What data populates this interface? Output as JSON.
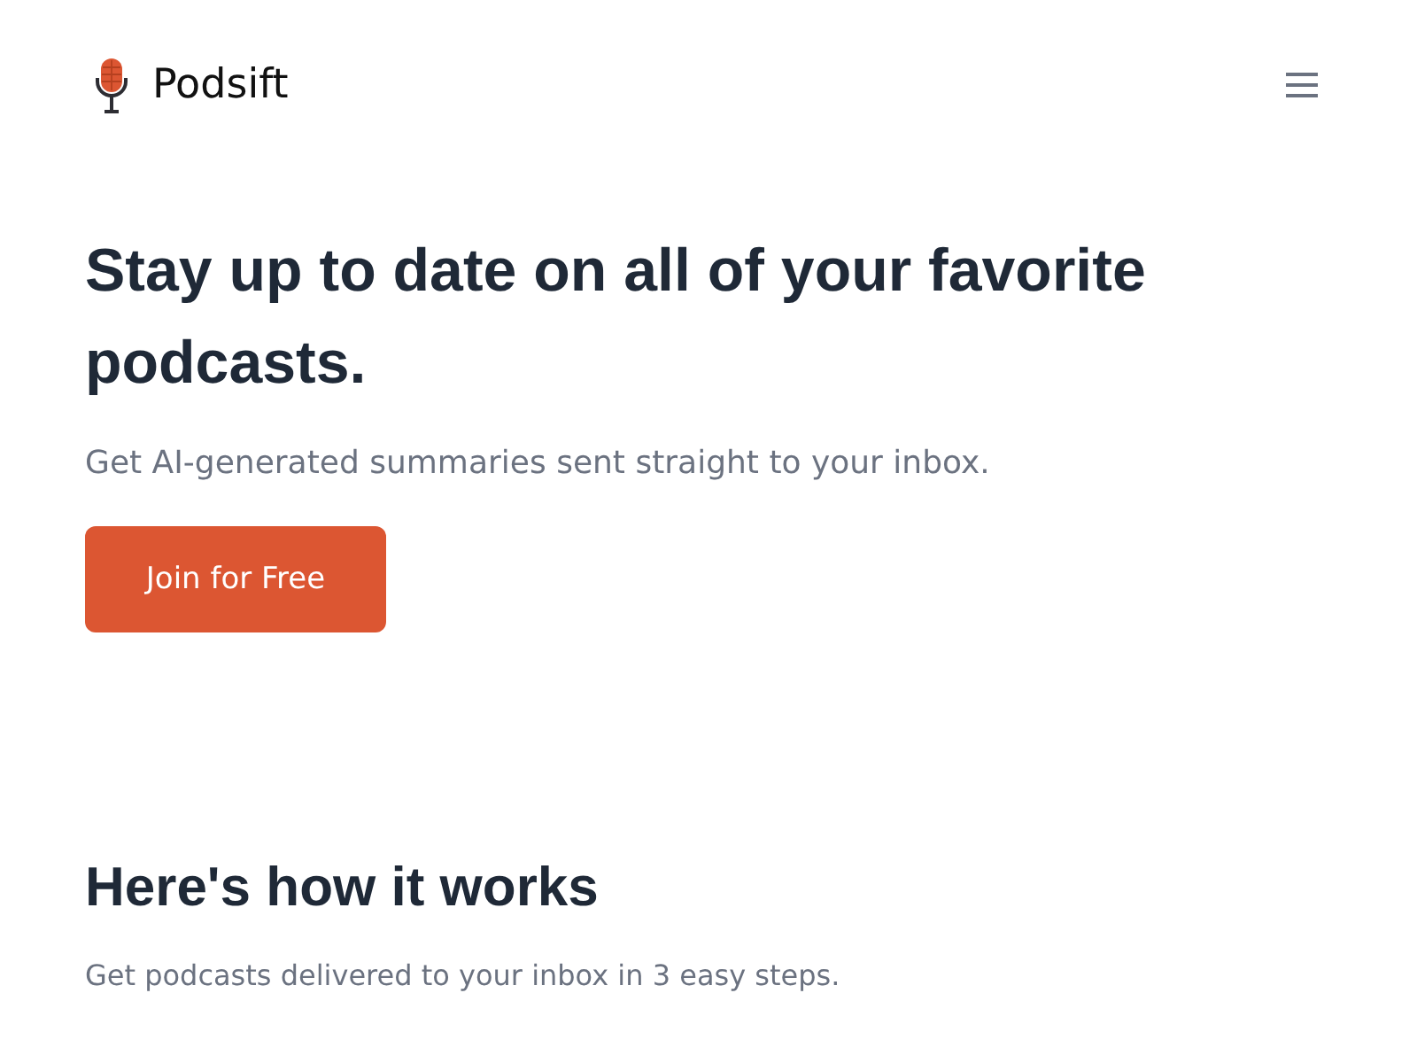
{
  "header": {
    "brand": "Podsift"
  },
  "hero": {
    "title": "Stay up to date on all of your favorite podcasts.",
    "subtitle": "Get AI-generated summaries sent straight to your inbox.",
    "cta": "Join for Free"
  },
  "how_it_works": {
    "title": "Here's how it works",
    "subtitle": "Get podcasts delivered to your inbox in 3 easy steps."
  }
}
